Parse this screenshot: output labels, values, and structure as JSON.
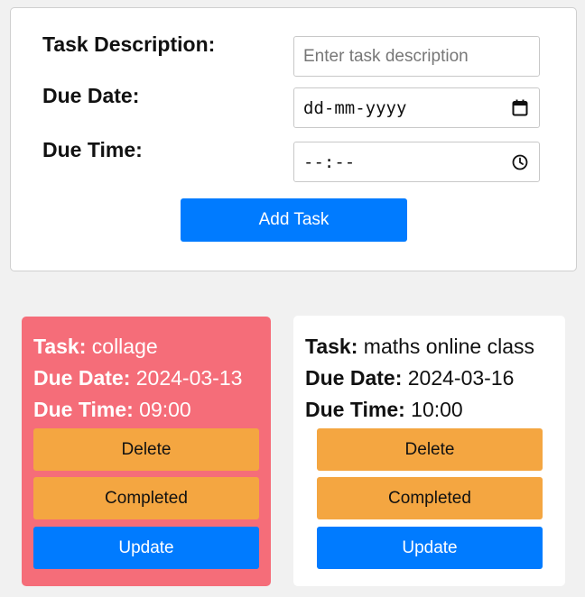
{
  "form": {
    "description_label": "Task Description:",
    "description_placeholder": "Enter task description",
    "description_value": "",
    "due_date_label": "Due Date:",
    "due_date_value": "dd-mm-yyyy",
    "due_time_label": "Due Time:",
    "due_time_value": "--:--",
    "add_button": "Add Task"
  },
  "labels": {
    "task": "Task:",
    "due_date": "Due Date:",
    "due_time": "Due Time:",
    "delete": "Delete",
    "completed": "Completed",
    "update": "Update"
  },
  "tasks": [
    {
      "description": "collage",
      "due_date": "2024-03-13",
      "due_time": "09:00",
      "status": "overdue"
    },
    {
      "description": "maths online class",
      "due_date": "2024-03-16",
      "due_time": "10:00",
      "status": "pending"
    }
  ],
  "colors": {
    "accent": "#007bff",
    "action": "#f4a641",
    "overdue": "#f56d79",
    "background": "#f1f1f1"
  },
  "icons": [
    "calendar-icon",
    "clock-icon"
  ]
}
